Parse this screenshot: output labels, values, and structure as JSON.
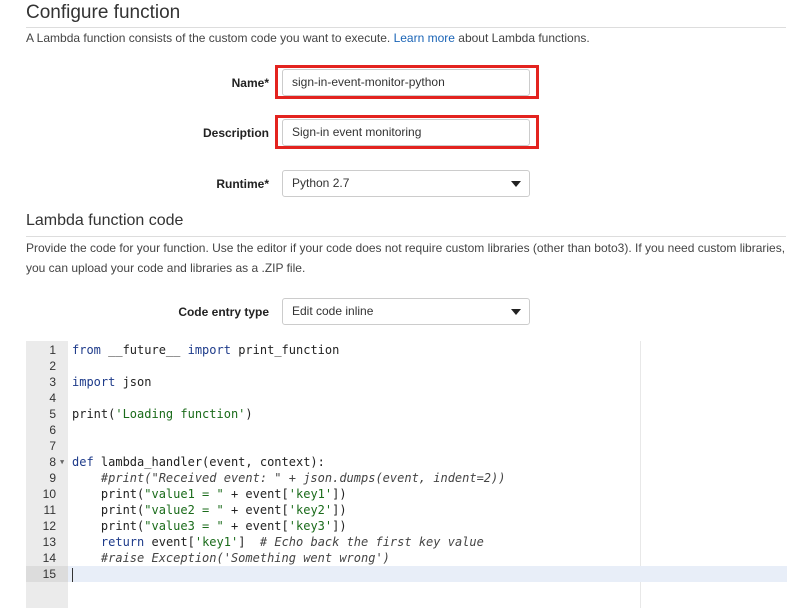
{
  "configure": {
    "title": "Configure function",
    "desc_before": "A Lambda function consists of the custom code you want to execute.",
    "learn_more": "Learn more",
    "desc_after": "about Lambda functions."
  },
  "form": {
    "name_label": "Name*",
    "name_value": "sign-in-event-monitor-python",
    "description_label": "Description",
    "description_value": "Sign-in event monitoring",
    "runtime_label": "Runtime*",
    "runtime_value": "Python 2.7"
  },
  "code_section": {
    "title": "Lambda function code",
    "desc_line1": "Provide the code for your function. Use the editor if your code does not require custom libraries (other than boto3). If you need custom libraries,",
    "desc_line2": "you can upload your code and libraries as a .ZIP file.",
    "entry_type_label": "Code entry type",
    "entry_type_value": "Edit code inline"
  },
  "editor": {
    "active_line": 15,
    "lines": [
      {
        "num": "1",
        "text": "from __future__ import print_function"
      },
      {
        "num": "2",
        "text": ""
      },
      {
        "num": "3",
        "text": "import json"
      },
      {
        "num": "4",
        "text": ""
      },
      {
        "num": "5",
        "text": "print('Loading function')"
      },
      {
        "num": "6",
        "text": ""
      },
      {
        "num": "7",
        "text": ""
      },
      {
        "num": "8",
        "text": "def lambda_handler(event, context):"
      },
      {
        "num": "9",
        "text": "    #print(\"Received event: \" + json.dumps(event, indent=2))"
      },
      {
        "num": "10",
        "text": "    print(\"value1 = \" + event['key1'])"
      },
      {
        "num": "11",
        "text": "    print(\"value2 = \" + event['key2'])"
      },
      {
        "num": "12",
        "text": "    print(\"value3 = \" + event['key3'])"
      },
      {
        "num": "13",
        "text": "    return event['key1']  # Echo back the first key value"
      },
      {
        "num": "14",
        "text": "    #raise Exception('Something went wrong')"
      },
      {
        "num": "15",
        "text": ""
      }
    ]
  }
}
